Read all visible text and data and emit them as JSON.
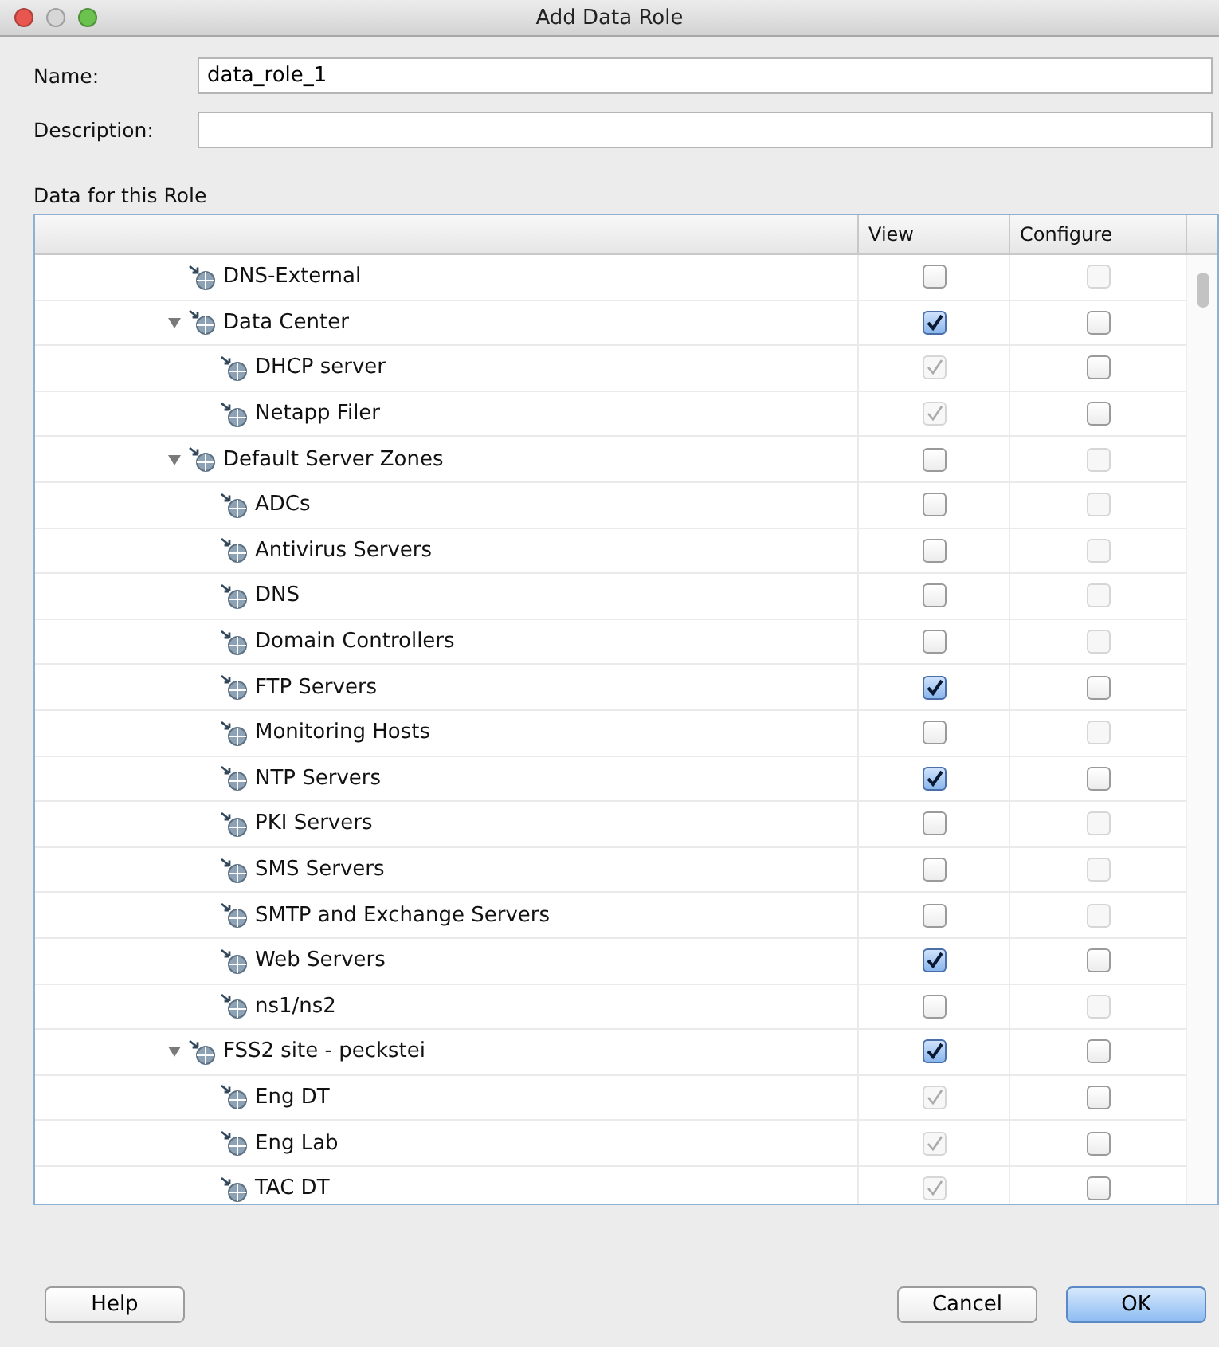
{
  "window": {
    "title": "Add Data Role"
  },
  "fields": [
    {
      "label": "Name:",
      "value": "data_role_1"
    },
    {
      "label": "Description:"
    }
  ],
  "section_title": "Data for this Role",
  "table": {
    "columns": [
      "View",
      "Configure"
    ],
    "rows": [
      {
        "label": "DNS-External",
        "view": {
          "checked": false,
          "disabled": false
        },
        "configure": {
          "checked": false,
          "disabled": true
        }
      },
      {
        "label": "Data Center",
        "expanded": true,
        "view": {
          "checked": true,
          "disabled": false
        },
        "configure": {
          "checked": false,
          "disabled": false
        },
        "children": [
          {
            "label": "DHCP server",
            "view": {
              "checked": true,
              "disabled": true
            },
            "configure": {
              "checked": false,
              "disabled": false
            }
          },
          {
            "label": "Netapp Filer",
            "view": {
              "checked": true,
              "disabled": true
            },
            "configure": {
              "checked": false,
              "disabled": false
            }
          }
        ]
      },
      {
        "label": "Default Server Zones",
        "expanded": true,
        "view": {
          "checked": false,
          "disabled": false
        },
        "configure": {
          "checked": false,
          "disabled": true
        },
        "children": [
          {
            "label": "ADCs",
            "view": {
              "checked": false,
              "disabled": false
            },
            "configure": {
              "checked": false,
              "disabled": true
            }
          },
          {
            "label": "Antivirus Servers",
            "view": {
              "checked": false,
              "disabled": false
            },
            "configure": {
              "checked": false,
              "disabled": true
            }
          },
          {
            "label": "DNS",
            "view": {
              "checked": false,
              "disabled": false
            },
            "configure": {
              "checked": false,
              "disabled": true
            }
          },
          {
            "label": "Domain Controllers",
            "view": {
              "checked": false,
              "disabled": false
            },
            "configure": {
              "checked": false,
              "disabled": true
            }
          },
          {
            "label": "FTP Servers",
            "view": {
              "checked": true,
              "disabled": false
            },
            "configure": {
              "checked": false,
              "disabled": false
            }
          },
          {
            "label": "Monitoring Hosts",
            "view": {
              "checked": false,
              "disabled": false
            },
            "configure": {
              "checked": false,
              "disabled": true
            }
          },
          {
            "label": "NTP Servers",
            "view": {
              "checked": true,
              "disabled": false
            },
            "configure": {
              "checked": false,
              "disabled": false
            }
          },
          {
            "label": "PKI Servers",
            "view": {
              "checked": false,
              "disabled": false
            },
            "configure": {
              "checked": false,
              "disabled": true
            }
          },
          {
            "label": "SMS Servers",
            "view": {
              "checked": false,
              "disabled": false
            },
            "configure": {
              "checked": false,
              "disabled": true
            }
          },
          {
            "label": "SMTP and Exchange Servers",
            "view": {
              "checked": false,
              "disabled": false
            },
            "configure": {
              "checked": false,
              "disabled": true
            }
          },
          {
            "label": "Web Servers",
            "view": {
              "checked": true,
              "disabled": false
            },
            "configure": {
              "checked": false,
              "disabled": false
            }
          },
          {
            "label": "ns1/ns2",
            "view": {
              "checked": false,
              "disabled": false
            },
            "configure": {
              "checked": false,
              "disabled": true
            }
          }
        ]
      },
      {
        "label": "FSS2 site - peckstei",
        "expanded": true,
        "view": {
          "checked": true,
          "disabled": false
        },
        "configure": {
          "checked": false,
          "disabled": false
        },
        "children": [
          {
            "label": "Eng DT",
            "view": {
              "checked": true,
              "disabled": true
            },
            "configure": {
              "checked": false,
              "disabled": false
            }
          },
          {
            "label": "Eng Lab",
            "view": {
              "checked": true,
              "disabled": true
            },
            "configure": {
              "checked": false,
              "disabled": false
            }
          },
          {
            "label": "TAC DT",
            "view": {
              "checked": true,
              "disabled": true
            },
            "configure": {
              "checked": false,
              "disabled": false
            }
          }
        ]
      }
    ]
  },
  "buttons": [
    {
      "label": "Help",
      "kind": "plain"
    },
    {
      "label": "Cancel",
      "kind": "plain"
    },
    {
      "label": "OK",
      "kind": "default"
    }
  ]
}
